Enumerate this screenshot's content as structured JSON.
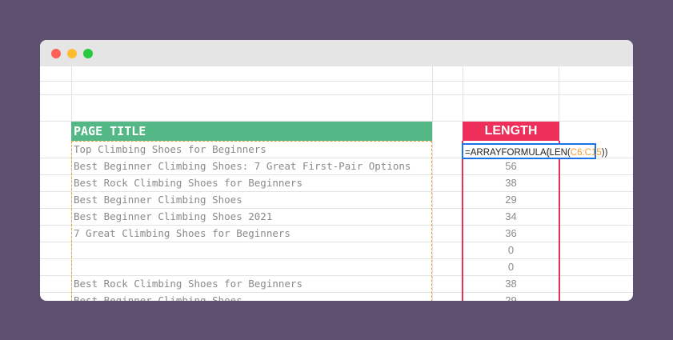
{
  "window": {
    "controls": {
      "close_color": "#ff5f57",
      "minimize_color": "#febc2e",
      "maximize_color": "#28c840"
    }
  },
  "sheet": {
    "title_header": "PAGE TITLE",
    "length_header": "LENGTH",
    "header_colors": {
      "title": "#54b886",
      "length": "#ee2f5a"
    },
    "formula": {
      "prefix": "=ARRAYFORMULA",
      "open1": "(",
      "func": "LEN(",
      "range": "C6:C15",
      "close": "))"
    },
    "rows": [
      {
        "title": "Top Climbing Shoes for Beginners",
        "length": ""
      },
      {
        "title": "Best Beginner Climbing Shoes: 7 Great First-Pair Options",
        "length": "56"
      },
      {
        "title": "Best Rock Climbing Shoes for Beginners",
        "length": "38"
      },
      {
        "title": "Best Beginner Climbing Shoes",
        "length": "29"
      },
      {
        "title": "Best Beginner Climbing Shoes 2021",
        "length": "34"
      },
      {
        "title": "7 Great Climbing Shoes for Beginners",
        "length": "36"
      },
      {
        "title": "",
        "length": "0"
      },
      {
        "title": "",
        "length": "0"
      },
      {
        "title": "Best Rock Climbing Shoes for Beginners",
        "length": "38"
      },
      {
        "title": "Best Beginner Climbing Shoes",
        "length": "29"
      }
    ]
  }
}
